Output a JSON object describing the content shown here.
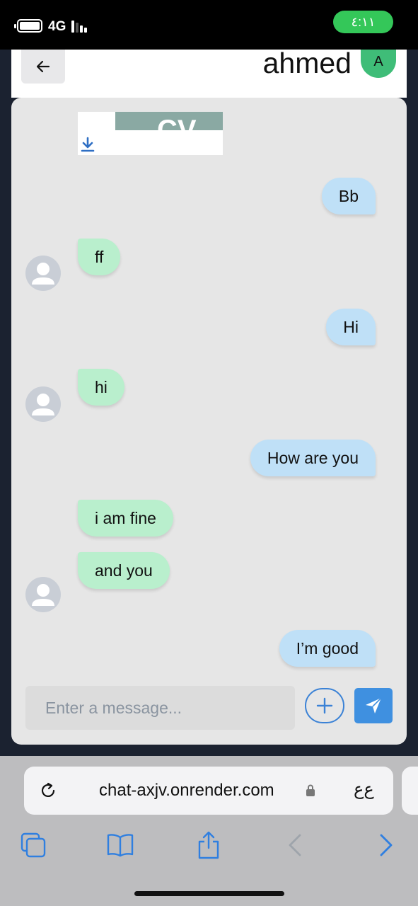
{
  "status_bar": {
    "network": "4G",
    "time": "٤:١١",
    "time_pill_color": "#34c759"
  },
  "header": {
    "title": "ahmed",
    "avatar_initial": "A",
    "back_icon": "arrow-left-icon"
  },
  "attachment": {
    "thumbnail_text": "CV",
    "download_icon": "download-icon"
  },
  "messages": [
    {
      "direction": "out",
      "text": "Bb"
    },
    {
      "direction": "in",
      "text": "ff"
    },
    {
      "direction": "out",
      "text": "Hi"
    },
    {
      "direction": "in",
      "text": "hi"
    },
    {
      "direction": "out",
      "text": "How are you"
    },
    {
      "direction": "in",
      "text": "i am fine"
    },
    {
      "direction": "in",
      "text": "and you"
    },
    {
      "direction": "out",
      "text": "I’m good"
    }
  ],
  "composer": {
    "placeholder": "Enter a message...",
    "value": "",
    "attach_icon": "plus-icon",
    "send_icon": "paper-plane-icon"
  },
  "browser": {
    "url": "chat-axjv.onrender.com",
    "text_size_button": "ع‌ع",
    "toolbar_icons": [
      "tabs-icon",
      "bookmarks-icon",
      "share-icon",
      "back-arrow-icon",
      "forward-arrow-icon"
    ]
  },
  "colors": {
    "outgoing_bubble": "#bfe0f7",
    "incoming_bubble": "#b9efcd",
    "accent": "#3f90e0",
    "avatar": "#3fbd78"
  }
}
